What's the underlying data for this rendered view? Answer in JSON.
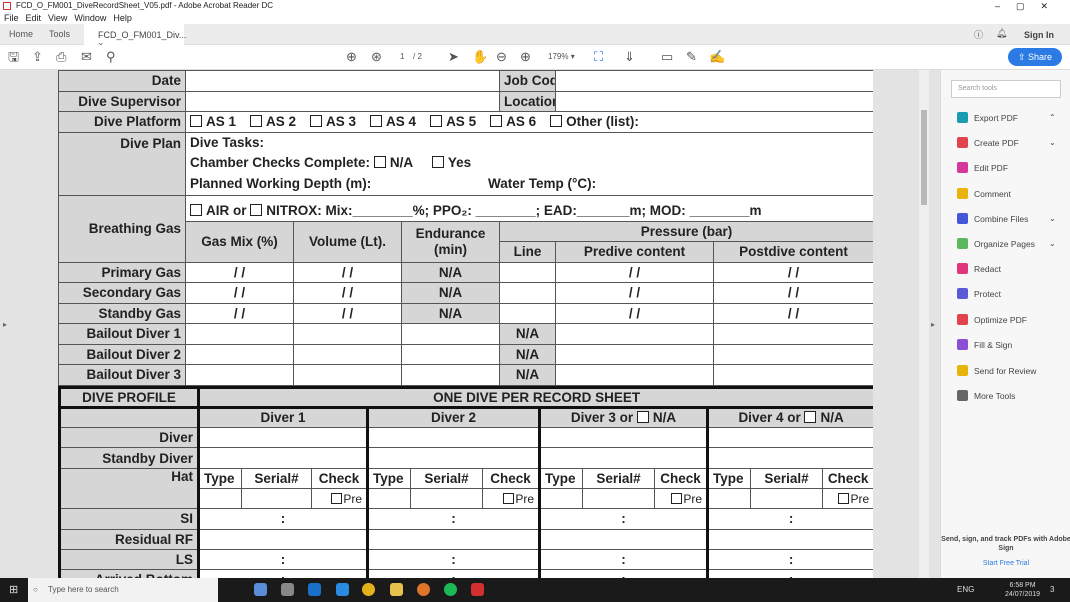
{
  "window": {
    "title": "FCD_O_FM001_DiveRecordSheet_V05.pdf - Adobe Acrobat Reader DC"
  },
  "menu": [
    "File",
    "Edit",
    "View",
    "Window",
    "Help"
  ],
  "tabs": {
    "home": "Home",
    "tools": "Tools",
    "document": "FCD_O_FM001_Div...",
    "close": "×",
    "sign_in": "Sign In"
  },
  "toolbar": {
    "page_current": "1",
    "page_total": "/ 2",
    "zoom": "179%",
    "share": "Share"
  },
  "form": {
    "date": "Date",
    "job_code": "Job Code",
    "supervisor": "Dive Supervisor",
    "location": "Location",
    "platform": "Dive Platform",
    "platform_options": [
      "AS 1",
      "AS 2",
      "AS 3",
      "AS 4",
      "AS 5",
      "AS 6",
      "Other (list):"
    ],
    "dive_plan": "Dive Plan",
    "dive_tasks": "Dive Tasks:",
    "chamber": "Chamber Checks Complete:",
    "na": "N/A",
    "yes": "Yes",
    "depth": "Planned Working Depth (m):",
    "water_temp": "Water Temp (°C):",
    "breathing_gas": "Breathing Gas",
    "gas_line": {
      "air": "AIR or",
      "nitrox": "NITROX: Mix:________%;  PPO₂: ________;  EAD:_______m;  MOD: ________m"
    },
    "headers": {
      "gas_mix": "Gas Mix (%)",
      "volume": "Volume (Lt).",
      "endurance": "Endurance (min)",
      "pressure": "Pressure (bar)",
      "line": "Line",
      "predive": "Predive content",
      "postdive": "Postdive content"
    },
    "slash": "/        /",
    "gas_rows": [
      "Primary Gas",
      "Secondary Gas",
      "Standby Gas"
    ],
    "bailout_rows": [
      "Bailout Diver 1",
      "Bailout Diver 2",
      "Bailout Diver 3"
    ]
  },
  "profile": {
    "title": "DIVE PROFILE",
    "subtitle": "ONE DIVE PER RECORD SHEET",
    "divers": [
      "Diver 1",
      "Diver 2",
      "Diver 3  or",
      "Diver 4  or"
    ],
    "na": "N/A",
    "rows": {
      "diver": "Diver",
      "standby": "Standby Diver",
      "hat": "Hat",
      "si": "SI",
      "residual": "Residual RF",
      "ls": "LS",
      "arrived": "Arrived Bottom"
    },
    "hat_cols": [
      "Type",
      "Serial#",
      "Check"
    ],
    "pre": "Pre",
    "colon": ":"
  },
  "tools_panel": {
    "search_placeholder": "Search tools",
    "items": [
      {
        "label": "Export PDF",
        "color": "#1a9bb0"
      },
      {
        "label": "Create PDF",
        "color": "#e0434b"
      },
      {
        "label": "Edit PDF",
        "color": "#d6379a"
      },
      {
        "label": "Comment",
        "color": "#e8b40c"
      },
      {
        "label": "Combine Files",
        "color": "#4357d8"
      },
      {
        "label": "Organize Pages",
        "color": "#5cb85c"
      },
      {
        "label": "Redact",
        "color": "#e0367a"
      },
      {
        "label": "Protect",
        "color": "#5a5ad6"
      },
      {
        "label": "Optimize PDF",
        "color": "#e0434b"
      },
      {
        "label": "Fill & Sign",
        "color": "#8a4fd6"
      },
      {
        "label": "Send for Review",
        "color": "#e8b40c"
      },
      {
        "label": "More Tools",
        "color": "#666666"
      }
    ],
    "promo": "Send, sign, and track PDFs with Adobe Sign",
    "trial": "Start Free Trial"
  },
  "taskbar": {
    "search": "Type here to search",
    "lang": "ENG",
    "time": "6:58 PM",
    "date": "24/07/2019",
    "notif": "3"
  }
}
